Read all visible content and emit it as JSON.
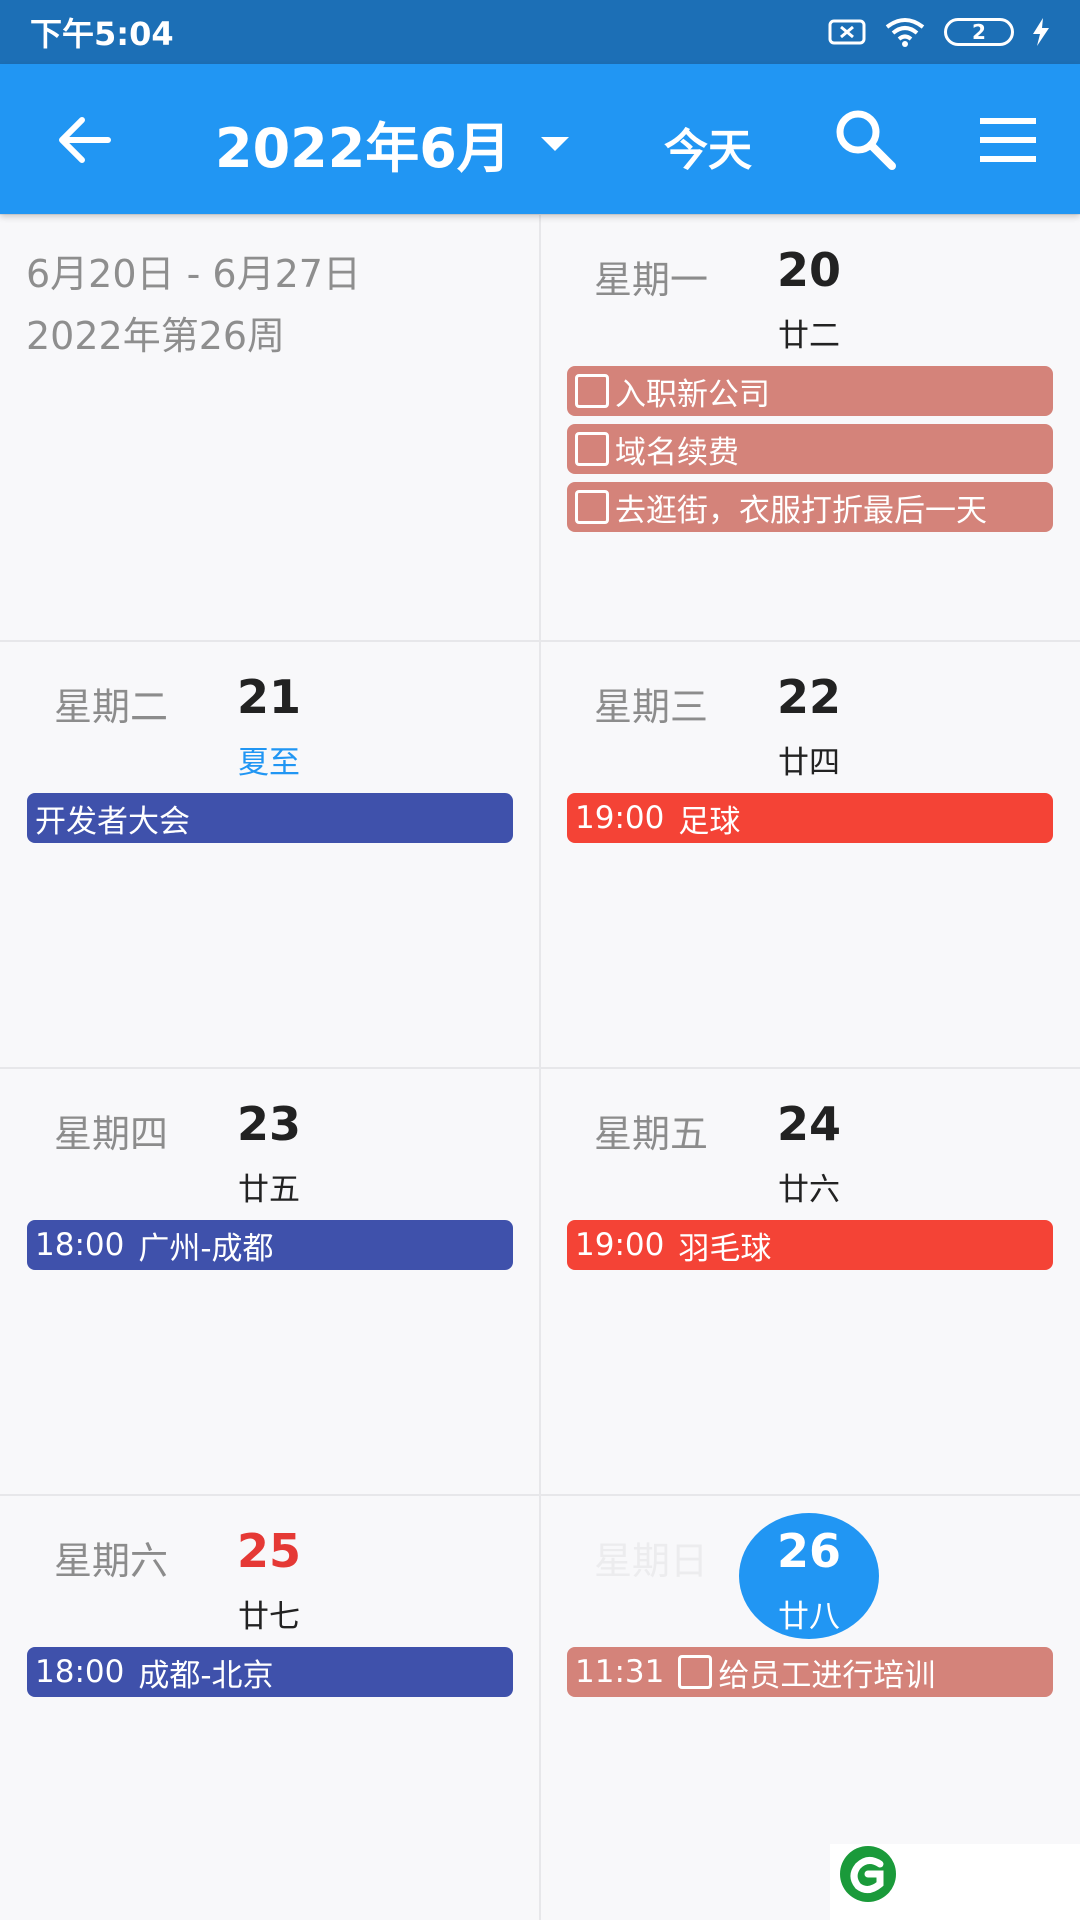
{
  "status_bar": {
    "time": "下午5:04",
    "battery": "2"
  },
  "app_bar": {
    "title": "2022年6月",
    "today_label": "今天"
  },
  "week_info": {
    "range": "6月20日 - 6月27日",
    "week": "2022年第26周"
  },
  "days": [
    {
      "weekday": "星期一",
      "day": "20",
      "lunar": "廿二",
      "events": [
        {
          "text": "入职新公司",
          "checkbox": true
        },
        {
          "text": "域名续费",
          "checkbox": true
        },
        {
          "text": "去逛街，衣服打折最后一天",
          "checkbox": true
        }
      ]
    },
    {
      "weekday": "星期二",
      "day": "21",
      "lunar": "夏至",
      "events": [
        {
          "text": "开发者大会"
        }
      ]
    },
    {
      "weekday": "星期三",
      "day": "22",
      "lunar": "廿四",
      "events": [
        {
          "time": "19:00",
          "text": "足球"
        }
      ]
    },
    {
      "weekday": "星期四",
      "day": "23",
      "lunar": "廿五",
      "events": [
        {
          "time": "18:00",
          "text": "广州-成都"
        }
      ]
    },
    {
      "weekday": "星期五",
      "day": "24",
      "lunar": "廿六",
      "events": [
        {
          "time": "19:00",
          "text": "羽毛球"
        }
      ]
    },
    {
      "weekday": "星期六",
      "day": "25",
      "lunar": "廿七",
      "events": [
        {
          "time": "18:00",
          "text": "成都-北京"
        }
      ]
    },
    {
      "weekday": "星期日",
      "day": "26",
      "lunar": "廿八",
      "events": [
        {
          "time": "11:31",
          "text": "给员工进行培训",
          "checkbox": true
        }
      ]
    }
  ],
  "colors": {
    "primary": "#2196f3",
    "status_bar": "#1c6fb6",
    "event_task": "#d4837a",
    "event_travel": "#3f51ab",
    "event_sport": "#f44336",
    "holiday_text": "#2196f3",
    "weekend_day": "#e53935"
  }
}
